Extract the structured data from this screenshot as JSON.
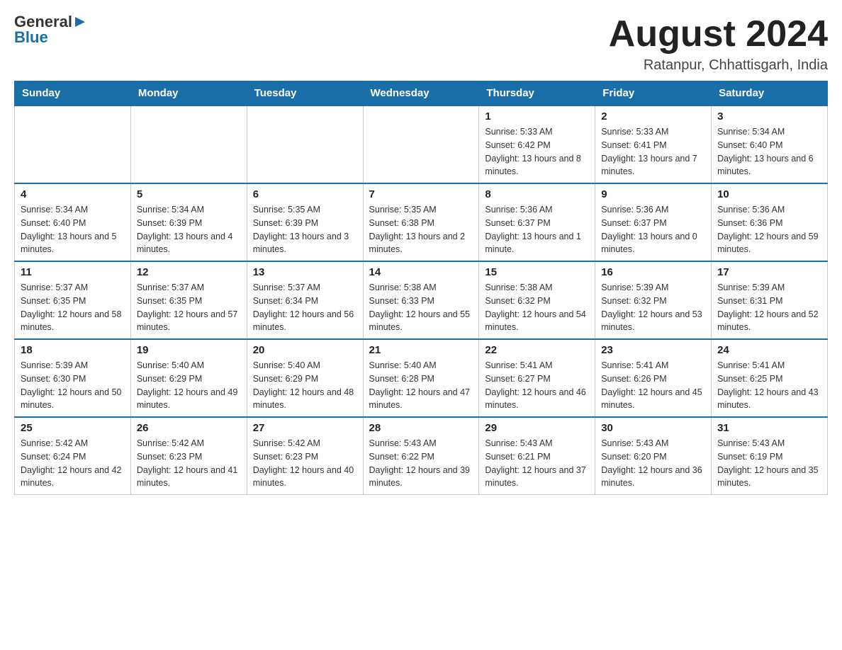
{
  "header": {
    "logo_general": "General",
    "logo_blue": "Blue",
    "month_title": "August 2024",
    "location": "Ratanpur, Chhattisgarh, India"
  },
  "days_of_week": [
    "Sunday",
    "Monday",
    "Tuesday",
    "Wednesday",
    "Thursday",
    "Friday",
    "Saturday"
  ],
  "weeks": [
    {
      "days": [
        {
          "number": "",
          "info": ""
        },
        {
          "number": "",
          "info": ""
        },
        {
          "number": "",
          "info": ""
        },
        {
          "number": "",
          "info": ""
        },
        {
          "number": "1",
          "info": "Sunrise: 5:33 AM\nSunset: 6:42 PM\nDaylight: 13 hours and 8 minutes."
        },
        {
          "number": "2",
          "info": "Sunrise: 5:33 AM\nSunset: 6:41 PM\nDaylight: 13 hours and 7 minutes."
        },
        {
          "number": "3",
          "info": "Sunrise: 5:34 AM\nSunset: 6:40 PM\nDaylight: 13 hours and 6 minutes."
        }
      ]
    },
    {
      "days": [
        {
          "number": "4",
          "info": "Sunrise: 5:34 AM\nSunset: 6:40 PM\nDaylight: 13 hours and 5 minutes."
        },
        {
          "number": "5",
          "info": "Sunrise: 5:34 AM\nSunset: 6:39 PM\nDaylight: 13 hours and 4 minutes."
        },
        {
          "number": "6",
          "info": "Sunrise: 5:35 AM\nSunset: 6:39 PM\nDaylight: 13 hours and 3 minutes."
        },
        {
          "number": "7",
          "info": "Sunrise: 5:35 AM\nSunset: 6:38 PM\nDaylight: 13 hours and 2 minutes."
        },
        {
          "number": "8",
          "info": "Sunrise: 5:36 AM\nSunset: 6:37 PM\nDaylight: 13 hours and 1 minute."
        },
        {
          "number": "9",
          "info": "Sunrise: 5:36 AM\nSunset: 6:37 PM\nDaylight: 13 hours and 0 minutes."
        },
        {
          "number": "10",
          "info": "Sunrise: 5:36 AM\nSunset: 6:36 PM\nDaylight: 12 hours and 59 minutes."
        }
      ]
    },
    {
      "days": [
        {
          "number": "11",
          "info": "Sunrise: 5:37 AM\nSunset: 6:35 PM\nDaylight: 12 hours and 58 minutes."
        },
        {
          "number": "12",
          "info": "Sunrise: 5:37 AM\nSunset: 6:35 PM\nDaylight: 12 hours and 57 minutes."
        },
        {
          "number": "13",
          "info": "Sunrise: 5:37 AM\nSunset: 6:34 PM\nDaylight: 12 hours and 56 minutes."
        },
        {
          "number": "14",
          "info": "Sunrise: 5:38 AM\nSunset: 6:33 PM\nDaylight: 12 hours and 55 minutes."
        },
        {
          "number": "15",
          "info": "Sunrise: 5:38 AM\nSunset: 6:32 PM\nDaylight: 12 hours and 54 minutes."
        },
        {
          "number": "16",
          "info": "Sunrise: 5:39 AM\nSunset: 6:32 PM\nDaylight: 12 hours and 53 minutes."
        },
        {
          "number": "17",
          "info": "Sunrise: 5:39 AM\nSunset: 6:31 PM\nDaylight: 12 hours and 52 minutes."
        }
      ]
    },
    {
      "days": [
        {
          "number": "18",
          "info": "Sunrise: 5:39 AM\nSunset: 6:30 PM\nDaylight: 12 hours and 50 minutes."
        },
        {
          "number": "19",
          "info": "Sunrise: 5:40 AM\nSunset: 6:29 PM\nDaylight: 12 hours and 49 minutes."
        },
        {
          "number": "20",
          "info": "Sunrise: 5:40 AM\nSunset: 6:29 PM\nDaylight: 12 hours and 48 minutes."
        },
        {
          "number": "21",
          "info": "Sunrise: 5:40 AM\nSunset: 6:28 PM\nDaylight: 12 hours and 47 minutes."
        },
        {
          "number": "22",
          "info": "Sunrise: 5:41 AM\nSunset: 6:27 PM\nDaylight: 12 hours and 46 minutes."
        },
        {
          "number": "23",
          "info": "Sunrise: 5:41 AM\nSunset: 6:26 PM\nDaylight: 12 hours and 45 minutes."
        },
        {
          "number": "24",
          "info": "Sunrise: 5:41 AM\nSunset: 6:25 PM\nDaylight: 12 hours and 43 minutes."
        }
      ]
    },
    {
      "days": [
        {
          "number": "25",
          "info": "Sunrise: 5:42 AM\nSunset: 6:24 PM\nDaylight: 12 hours and 42 minutes."
        },
        {
          "number": "26",
          "info": "Sunrise: 5:42 AM\nSunset: 6:23 PM\nDaylight: 12 hours and 41 minutes."
        },
        {
          "number": "27",
          "info": "Sunrise: 5:42 AM\nSunset: 6:23 PM\nDaylight: 12 hours and 40 minutes."
        },
        {
          "number": "28",
          "info": "Sunrise: 5:43 AM\nSunset: 6:22 PM\nDaylight: 12 hours and 39 minutes."
        },
        {
          "number": "29",
          "info": "Sunrise: 5:43 AM\nSunset: 6:21 PM\nDaylight: 12 hours and 37 minutes."
        },
        {
          "number": "30",
          "info": "Sunrise: 5:43 AM\nSunset: 6:20 PM\nDaylight: 12 hours and 36 minutes."
        },
        {
          "number": "31",
          "info": "Sunrise: 5:43 AM\nSunset: 6:19 PM\nDaylight: 12 hours and 35 minutes."
        }
      ]
    }
  ]
}
